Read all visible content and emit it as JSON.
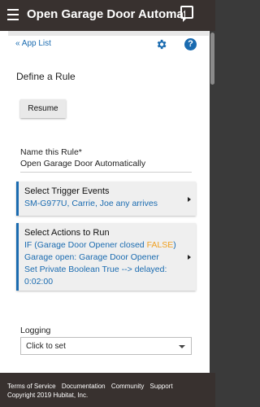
{
  "app_bar": {
    "title": "Open Garage Door Automatical",
    "menu_icon": "menu-icon",
    "chat_icon": "chat-icon"
  },
  "nav": {
    "app_list": "« App List",
    "settings_icon": "gear-icon",
    "help_icon": "help-icon",
    "help_glyph": "?"
  },
  "page": {
    "section_title": "Define a Rule",
    "resume_label": "Resume",
    "name_label": "Name this Rule*",
    "name_value": "Open Garage Door Automatically"
  },
  "trigger": {
    "title": "Select Trigger Events",
    "summary": "SM-G977U, Carrie, Joe any arrives"
  },
  "actions": {
    "title": "Select Actions to Run",
    "line1_prefix": "IF (Garage Door Opener closed ",
    "line1_false": "FALSE",
    "line1_suffix": ")",
    "line2": "Garage open: Garage Door Opener",
    "line3": "Set Private Boolean True --> delayed:",
    "line4": "0:02:00"
  },
  "logging": {
    "label": "Logging",
    "placeholder": "Click to set"
  },
  "footer": {
    "links": [
      "Terms of Service",
      "Documentation",
      "Community",
      "Support"
    ],
    "copyright": "Copyright 2019 Hubitat, Inc."
  },
  "colors": {
    "app_bar": "#38312f",
    "accent": "#1a6bb0",
    "false_highlight": "#f0a020"
  }
}
